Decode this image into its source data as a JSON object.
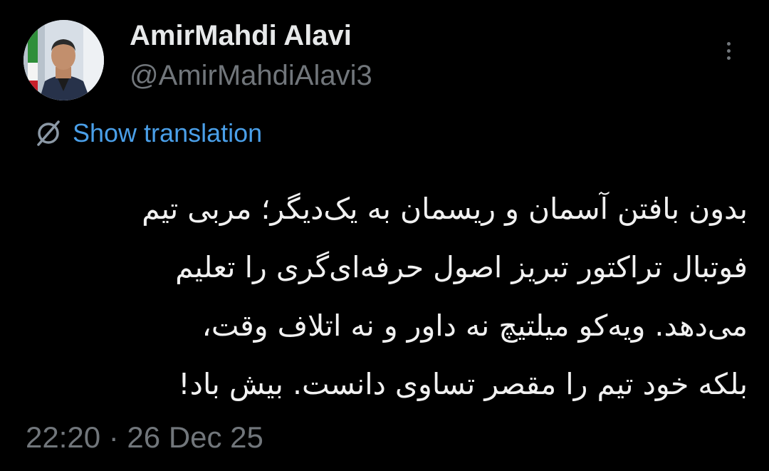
{
  "author": {
    "display_name": "AmirMahdi Alavi",
    "handle": "@AmirMahdiAlavi3",
    "avatar_icon": "profile-photo"
  },
  "menu": {
    "icon": "more-vertical-icon"
  },
  "translation": {
    "icon": "globe-translate-icon",
    "label": "Show translation",
    "color": "#4a9fe8"
  },
  "tweet": {
    "lines": [
      "بدون بافتن آسمان و ریسمان به یک‌دیگر؛ مربی تیم",
      "فوتبال تراکتور تبریز اصول حرفه‌ای‌گری را تعلیم",
      "می‌دهد. ویه‌کو میلتیچ نه داور و نه اتلاف وقت،",
      "بلکه خود تیم را مقصر تساوی دانست. بیش باد!"
    ]
  },
  "meta": {
    "timestamp": "22:20 · 26 Dec 25"
  },
  "colors": {
    "background": "#000000",
    "primary_text": "#e7e9ea",
    "secondary_text": "#71767b",
    "link": "#4a9fe8"
  }
}
